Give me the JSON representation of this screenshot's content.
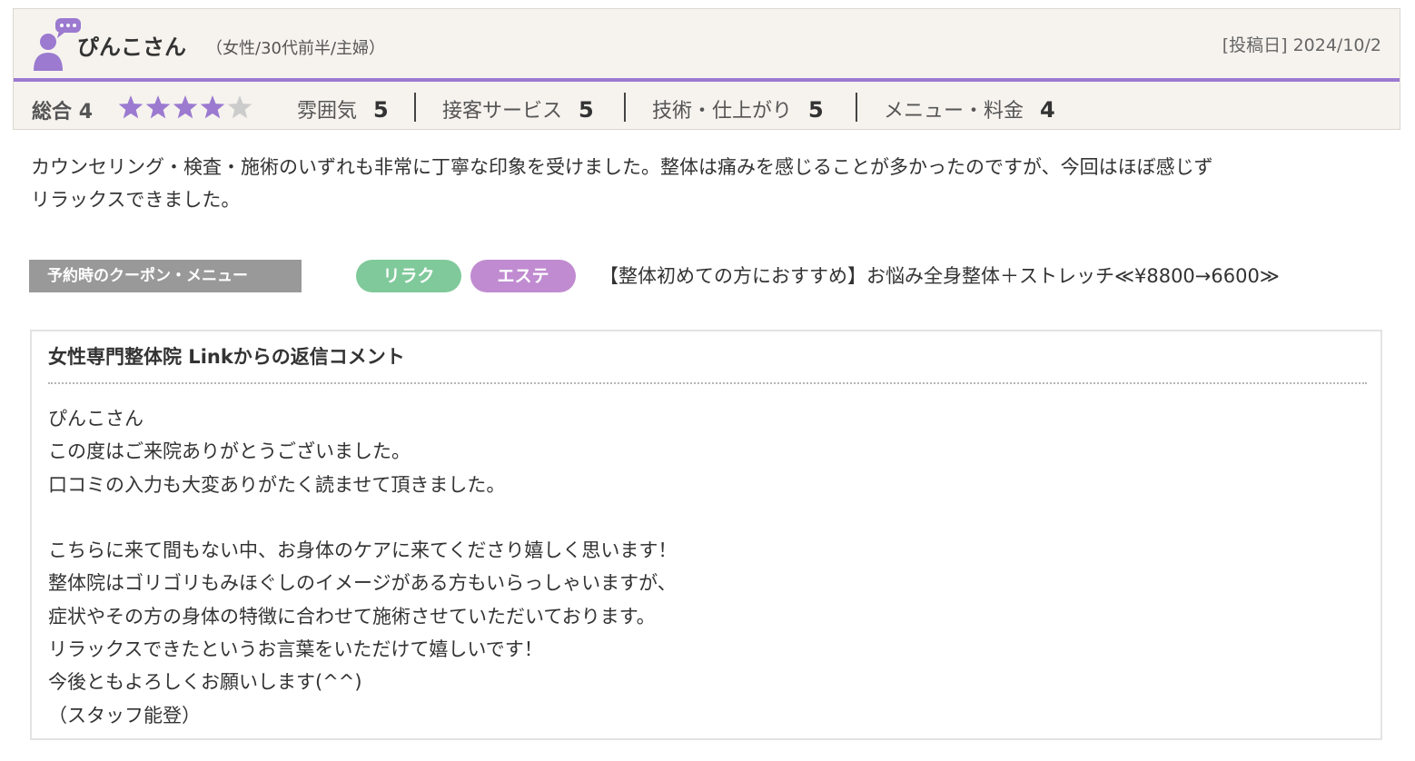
{
  "reviewer": {
    "name": "ぴんこさん",
    "attributes": "（女性/30代前半/主婦）",
    "post_date": "[投稿日] 2024/10/2"
  },
  "ratings": {
    "overall_label": "総合",
    "overall_value": "4",
    "overall_stars": 4,
    "stars_max": 5,
    "items": [
      {
        "label": "雰囲気",
        "value": "5"
      },
      {
        "label": "接客サービス",
        "value": "5"
      },
      {
        "label": "技術・仕上がり",
        "value": "5"
      },
      {
        "label": "メニュー・料金",
        "value": "4"
      }
    ]
  },
  "review_text": {
    "line1": "カウンセリング・検査・施術のいずれも非常に丁寧な印象を受けました。整体は痛みを感じることが多かったのですが、今回はほぼ感じず",
    "line2": "リラックスできました。"
  },
  "coupon": {
    "label": "予約時のクーポン・メニュー",
    "tags": [
      "リラク",
      "エステ"
    ],
    "text": "【整体初めての方におすすめ】お悩み全身整体＋ストレッチ≪¥8800→6600≫"
  },
  "reply": {
    "title": "女性専門整体院 Linkからの返信コメント",
    "lines": [
      "ぴんこさん",
      "この度はご来院ありがとうございました。",
      "口コミの入力も大変ありがたく読ませて頂きました。",
      "",
      "こちらに来て間もない中、お身体のケアに来てくださり嬉しく思います！",
      "整体院はゴリゴリもみほぐしのイメージがある方もいらっしゃいますが、",
      "症状やその方の身体の特徴に合わせて施術させていただいております。",
      "リラックスできたというお言葉をいただけて嬉しいです！",
      "今後ともよろしくお願いします(^^)",
      "（スタッフ能登）"
    ]
  },
  "colors": {
    "accent_purple": "#9b7ad0",
    "star_filled": "#9b7ad0",
    "star_empty": "#cccccc",
    "tag_relax": "#7fc99a",
    "tag_esthe": "#c08bd0"
  },
  "icons": {
    "avatar": "user-comment-icon",
    "star": "star-icon"
  }
}
